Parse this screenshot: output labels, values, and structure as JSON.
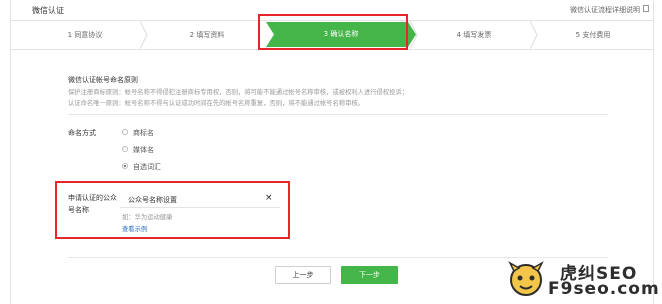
{
  "header": {
    "title": "微信认证",
    "help_link": "微信认证流程详细说明"
  },
  "steps": [
    {
      "label": "1 同意协议"
    },
    {
      "label": "2 填写资料"
    },
    {
      "label": "3 确认名称"
    },
    {
      "label": "4 填写发票"
    },
    {
      "label": "5 支付费用"
    }
  ],
  "rules": {
    "title": "微信认证帐号命名原则",
    "line1": "保护注册商标原则：帐号名称不得侵犯注册商标专用权，否则，将可能不能通过帐号名称审核，或被权利人进行侵权投诉；",
    "line2": "认证命名唯一原则：帐号名称不得与认证成功时间在先的帐号名称重复，否则，将不能通过帐号名称审核。"
  },
  "naming": {
    "label": "命名方式",
    "options": [
      {
        "label": "商标名",
        "checked": false
      },
      {
        "label": "媒体名",
        "checked": false
      },
      {
        "label": "自选词汇",
        "checked": true
      }
    ]
  },
  "name_field": {
    "label": "申请认证的公众号名称",
    "value": "公众号名称设置",
    "clear": "×",
    "hint": "如：华为运动健康",
    "example_link": "查看示例"
  },
  "buttons": {
    "prev": "上一步",
    "next": "下一步"
  },
  "watermark": {
    "line1": "虎纠SEO",
    "line2": "F9seo.com"
  },
  "colors": {
    "accent_green": "#44b549",
    "highlight_red": "#e8262a",
    "link_blue": "#2b6fc0"
  }
}
